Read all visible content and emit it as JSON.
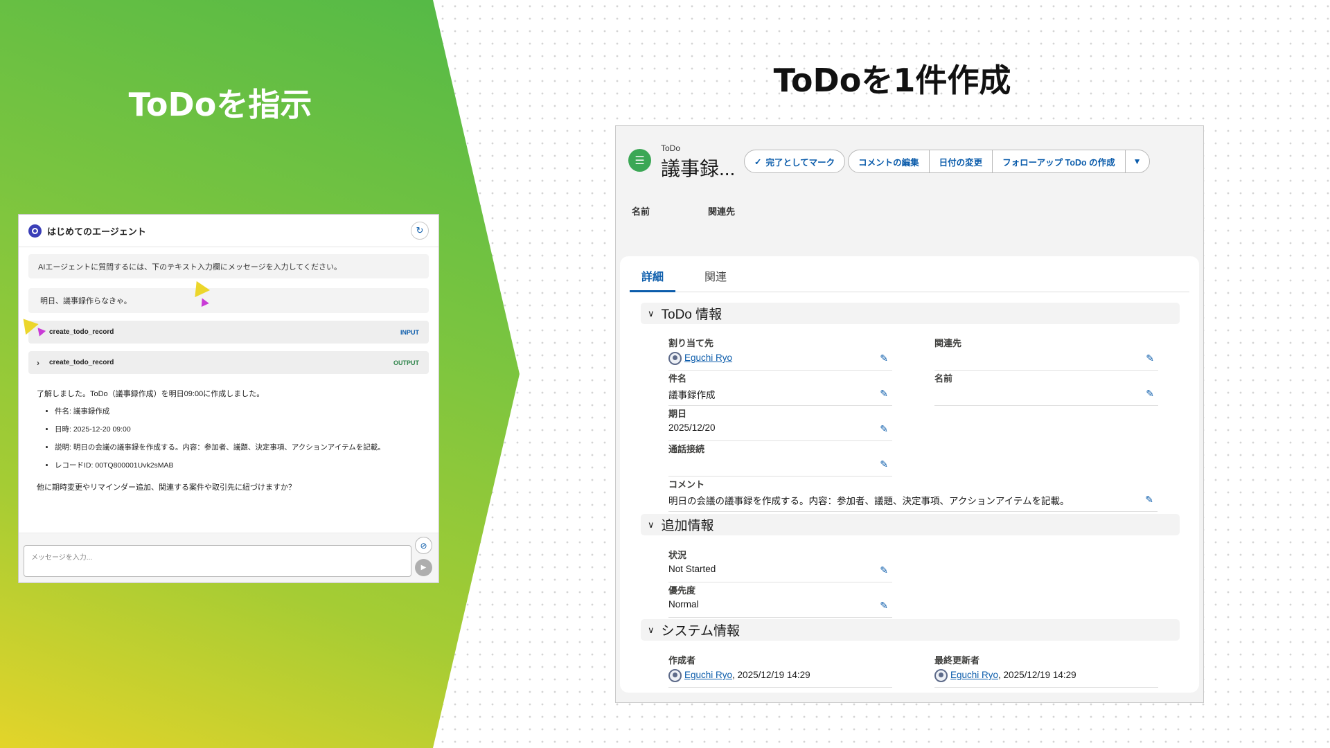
{
  "slide": {
    "left_title": "ToDoを指示",
    "right_title": "ToDoを1件作成"
  },
  "colors": {
    "accent": "#0b5cab",
    "gradient_top": "#52b947",
    "gradient_bottom": "#e3d42a",
    "todo_icon": "#3ba755"
  },
  "chat": {
    "agent_name": "はじめてのエージェント",
    "intro": "AIエージェントに質問するには、下のテキスト入力欄にメッセージを入力してください。",
    "user_message": "明日、議事録作らなきゃ。",
    "tool_input": {
      "name": "create_todo_record",
      "badge": "INPUT"
    },
    "tool_output": {
      "name": "create_todo_record",
      "badge": "OUTPUT"
    },
    "reply": {
      "intro": "了解しました。ToDo（議事録作成）を明日09:00に作成しました。",
      "items": [
        "件名: 議事録作成",
        "日時: 2025-12-20 09:00",
        "説明: 明日の会議の議事録を作成する。内容：参加者、議題、決定事項、アクションアイテムを記載。",
        "レコードID: 00TQ800001Uvk2sMAB"
      ],
      "closing": "他に期時変更やリマインダー追加、関連する案件や取引先に紐づけますか？"
    },
    "input_placeholder": "メッセージを入力...",
    "icons": {
      "refresh": "refresh-icon",
      "attach": "paperclip-icon",
      "send": "send-icon"
    }
  },
  "record": {
    "object_type": "ToDo",
    "title": "議事録...",
    "actions": {
      "complete": "完了としてマーク",
      "edit_comment": "コメントの編集",
      "change_date": "日付の変更",
      "followup": "フォローアップ ToDo の作成"
    },
    "highlights": {
      "name_label": "名前",
      "related_label": "関連先"
    },
    "tabs": {
      "detail": "詳細",
      "related": "関連"
    },
    "sections": {
      "todo": "ToDo 情報",
      "additional": "追加情報",
      "system": "システム情報"
    },
    "fields": {
      "assignee": {
        "label": "割り当て先",
        "value": "Eguchi Ryo"
      },
      "related": {
        "label": "関連先",
        "value": ""
      },
      "subject": {
        "label": "件名",
        "value": "議事録作成"
      },
      "name": {
        "label": "名前",
        "value": ""
      },
      "due": {
        "label": "期日",
        "value": "2025/12/20"
      },
      "call": {
        "label": "通話接続",
        "value": ""
      },
      "comment": {
        "label": "コメント",
        "value": "明日の会議の議事録を作成する。内容：参加者、議題、決定事項、アクションアイテムを記載。"
      },
      "status": {
        "label": "状況",
        "value": "Not Started"
      },
      "priority": {
        "label": "優先度",
        "value": "Normal"
      },
      "created_by": {
        "label": "作成者",
        "user": "Eguchi Ryo",
        "date": ", 2025/12/19 14:29"
      },
      "modified_by": {
        "label": "最終更新者",
        "user": "Eguchi Ryo",
        "date": ", 2025/12/19 14:29"
      }
    }
  }
}
